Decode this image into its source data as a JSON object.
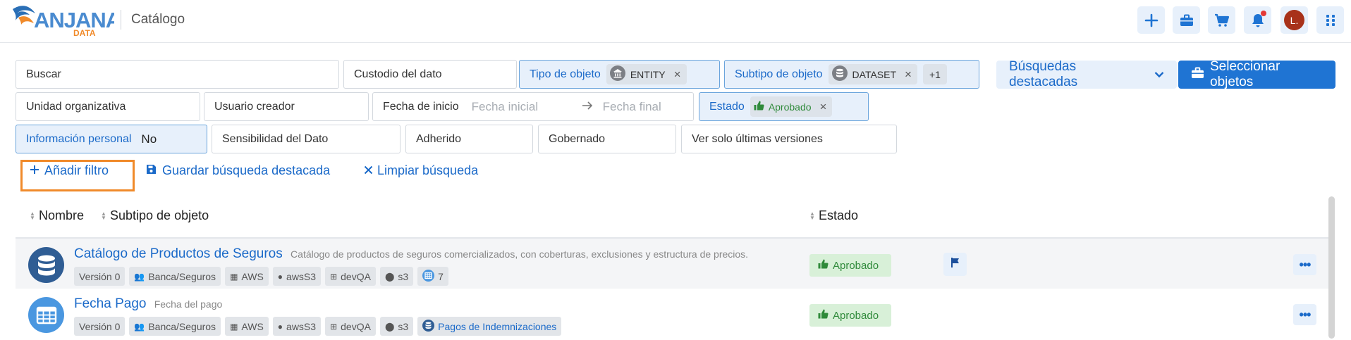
{
  "header": {
    "logo_text": "ANJANA",
    "logo_sub": "DATA",
    "title": "Catálogo",
    "avatar_initial": "L.",
    "icons": [
      "plus-icon",
      "briefcase-icon",
      "cart-icon",
      "bell-icon",
      "grid-icon"
    ]
  },
  "filters": {
    "buscar": "Buscar",
    "custodio": "Custodio del dato",
    "tipo": {
      "label": "Tipo de objeto",
      "chip": "ENTITY"
    },
    "subtipo": {
      "label": "Subtipo de objeto",
      "chip": "DATASET",
      "more": "+1"
    },
    "unidad": "Unidad organizativa",
    "usuario": "Usuario creador",
    "fecha": {
      "label": "Fecha de inicio",
      "from_placeholder": "Fecha inicial",
      "to_placeholder": "Fecha final"
    },
    "estado": {
      "label": "Estado",
      "chip": "Aprobado"
    },
    "info_personal": {
      "label": "Información personal",
      "value": "No"
    },
    "sensibilidad": "Sensibilidad del Dato",
    "adherido": "Adherido",
    "gobernado": "Gobernado",
    "ultimas": "Ver solo últimas versiones"
  },
  "buttons": {
    "busquedas": "Búsquedas destacadas",
    "seleccionar": "Seleccionar objetos"
  },
  "actions": {
    "add_filter": "Añadir filtro",
    "save_search": "Guardar búsqueda destacada",
    "clear_search": "Limpiar búsqueda"
  },
  "table": {
    "columns": {
      "nombre": "Nombre",
      "subtipo": "Subtipo de objeto",
      "estado": "Estado"
    },
    "rows": [
      {
        "title": "Catálogo de Productos de Seguros",
        "description": "Catálogo de productos de seguros comercializados, con coberturas, exclusiones y estructura de precios.",
        "icon": "database-icon",
        "tags": {
          "version": "Versión 0",
          "org": "Banca/Seguros",
          "provider": "AWS",
          "location": "awsS3",
          "env": "devQA",
          "path": "s3",
          "count": "7"
        },
        "status": "Aprobado",
        "flagged": true
      },
      {
        "title": "Fecha Pago",
        "description": "Fecha del pago",
        "icon": "table-icon",
        "tags": {
          "version": "Versión 0",
          "org": "Banca/Seguros",
          "provider": "AWS",
          "location": "awsS3",
          "env": "devQA",
          "path": "s3",
          "parent": "Pagos de Indemnizaciones"
        },
        "status": "Aprobado",
        "flagged": false
      }
    ]
  },
  "colors": {
    "primary": "#1f74d3",
    "accent_light": "#e7f0fb",
    "highlight": "#f08a2a",
    "approved_bg": "#d8f0d8",
    "approved_text": "#2f8a3a"
  }
}
